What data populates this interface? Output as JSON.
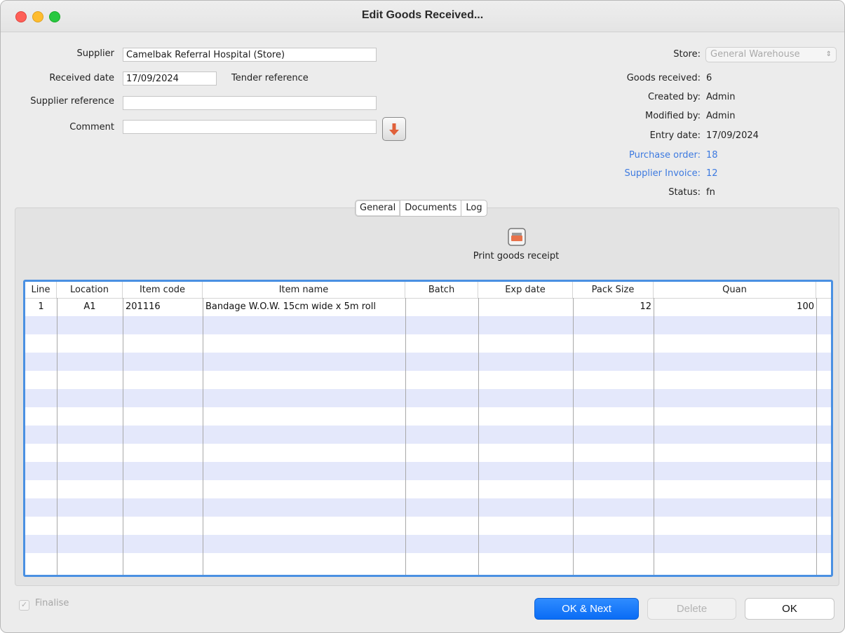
{
  "window": {
    "title": "Edit Goods Received..."
  },
  "form": {
    "supplier_label": "Supplier",
    "supplier_value": "Camelbak Referral Hospital (Store)",
    "received_date_label": "Received date",
    "received_date_value": "17/09/2024",
    "tender_reference_label": "Tender reference",
    "supplier_reference_label": "Supplier reference",
    "supplier_reference_value": "",
    "comment_label": "Comment",
    "comment_value": ""
  },
  "info": {
    "store_label": "Store:",
    "store_value": "General Warehouse",
    "goods_received_label": "Goods received:",
    "goods_received_value": "6",
    "created_by_label": "Created by:",
    "created_by_value": "Admin",
    "modified_by_label": "Modified by:",
    "modified_by_value": "Admin",
    "entry_date_label": "Entry date:",
    "entry_date_value": "17/09/2024",
    "purchase_order_label": "Purchase order:",
    "purchase_order_value": "18",
    "supplier_invoice_label": "Supplier Invoice:",
    "supplier_invoice_value": "12",
    "status_label": "Status:",
    "status_value": "fn"
  },
  "tabs": [
    {
      "label": "General",
      "selected": true
    },
    {
      "label": "Documents",
      "selected": false
    },
    {
      "label": "Log",
      "selected": false
    }
  ],
  "toolbar": {
    "print_label": "Print goods receipt"
  },
  "table": {
    "columns": [
      "Line",
      "Location",
      "Item code",
      "Item name",
      "Batch",
      "Exp date",
      "Pack Size",
      "Quan"
    ],
    "rows": [
      {
        "line": "1",
        "location": "A1",
        "item_code": "201116",
        "item_name": "Bandage W.O.W. 15cm wide x 5m roll",
        "batch": "",
        "exp_date": "",
        "pack_size": "12",
        "quantity": "100"
      }
    ]
  },
  "footer": {
    "finalise_label": "Finalise",
    "finalise_checked": true,
    "ok_next_label": "OK & Next",
    "delete_label": "Delete",
    "ok_label": "OK"
  },
  "colors": {
    "accent": "#0a6cf5",
    "link": "#3d7ae0",
    "stripe": "#e4e8fb",
    "table_border": "#4a90e2"
  }
}
